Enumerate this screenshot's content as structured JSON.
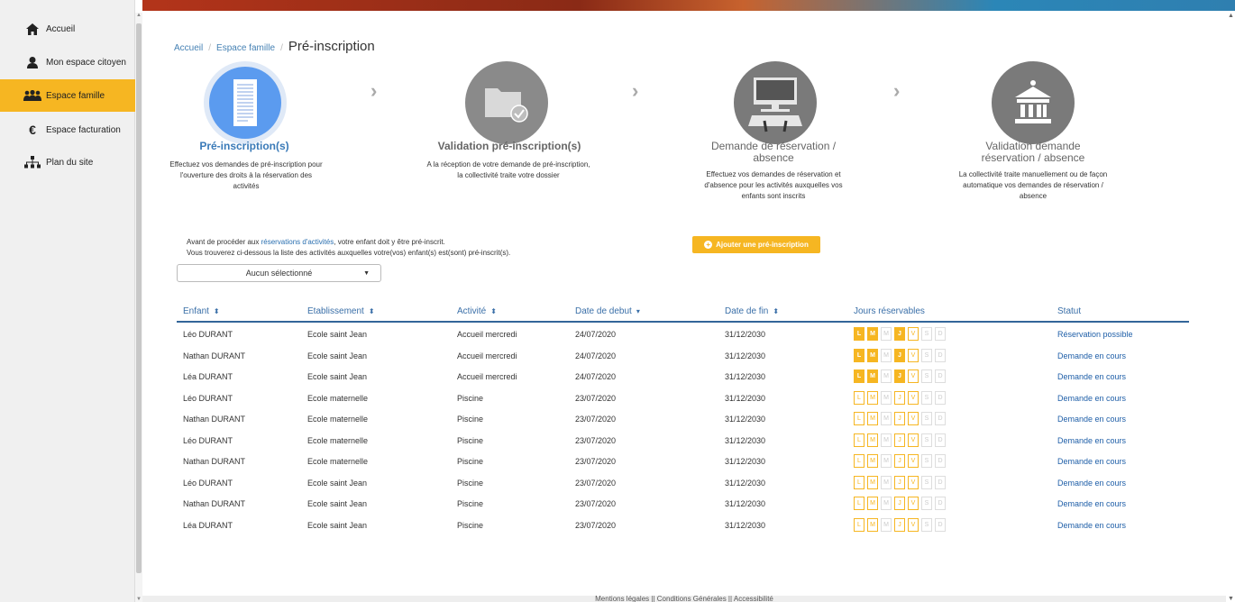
{
  "sidebar": {
    "items": [
      {
        "label": "Accueil",
        "icon": "home-icon",
        "active": false
      },
      {
        "label": "Mon espace citoyen",
        "icon": "user-icon",
        "active": false
      },
      {
        "label": "Espace famille",
        "icon": "family-icon",
        "active": true
      },
      {
        "label": "Espace facturation",
        "icon": "euro-icon",
        "active": false
      },
      {
        "label": "Plan du site",
        "icon": "sitemap-icon",
        "active": false
      }
    ]
  },
  "breadcrumb": {
    "items": [
      "Accueil",
      "Espace famille"
    ],
    "separator": "/",
    "current": "Pré-inscription"
  },
  "steps": [
    {
      "title": "Pré-inscription(s)",
      "desc": "Effectuez vos demandes de pré-inscription pour l'ouverture des droits à la réservation des activités",
      "icon": "document-icon",
      "active": true
    },
    {
      "title": "Validation pré-inscription(s)",
      "desc": "A la réception de votre demande de pré-inscription, la collectivité traite votre dossier",
      "icon": "folder-check-icon",
      "active": false
    },
    {
      "title": "Demande de réservation / absence",
      "desc": "Effectuez vos demandes de réservation et d'absence pour les activités auxquelles vos enfants sont inscrits",
      "icon": "computer-icon",
      "active": false
    },
    {
      "title": "Validation demande réservation / absence",
      "desc": "La collectivité traite manuellement ou de façon automatique vos demandes de réservation / absence",
      "icon": "institution-icon",
      "active": false
    }
  ],
  "intro": {
    "line1_before": "Avant de procéder aux ",
    "line1_link": "réservations d'activités",
    "line1_after": ", votre enfant doit y être pré-inscrit.",
    "line2": "Vous trouverez ci-dessous la liste des activités auxquelles votre(vos) enfant(s) est(sont) pré-inscrit(s)."
  },
  "add_button": "Ajouter une pré-inscription",
  "select": {
    "value": "Aucun sélectionné"
  },
  "table": {
    "headers": [
      "Enfant",
      "Etablissement",
      "Activité",
      "Date de debut",
      "Date de fin",
      "Jours réservables",
      "Statut"
    ],
    "day_letters": [
      "L",
      "M",
      "M",
      "J",
      "V",
      "S",
      "D"
    ],
    "rows": [
      {
        "enfant": "Léo DURANT",
        "etab": "Ecole saint Jean",
        "activite": "Accueil mercredi",
        "debut": "24/07/2020",
        "fin": "31/12/2030",
        "days": [
          "on",
          "on",
          "off",
          "on",
          "avail",
          "off",
          "off"
        ],
        "statut": "Réservation possible"
      },
      {
        "enfant": "Nathan DURANT",
        "etab": "Ecole saint Jean",
        "activite": "Accueil mercredi",
        "debut": "24/07/2020",
        "fin": "31/12/2030",
        "days": [
          "on",
          "on",
          "off",
          "on",
          "avail",
          "off",
          "off"
        ],
        "statut": "Demande en cours"
      },
      {
        "enfant": "Léa DURANT",
        "etab": "Ecole saint Jean",
        "activite": "Accueil mercredi",
        "debut": "24/07/2020",
        "fin": "31/12/2030",
        "days": [
          "on",
          "on",
          "off",
          "on",
          "avail",
          "off",
          "off"
        ],
        "statut": "Demande en cours"
      },
      {
        "enfant": "Léo DURANT",
        "etab": "Ecole maternelle",
        "activite": "Piscine",
        "debut": "23/07/2020",
        "fin": "31/12/2030",
        "days": [
          "avail",
          "avail",
          "off",
          "avail",
          "avail",
          "off",
          "off"
        ],
        "statut": "Demande en cours"
      },
      {
        "enfant": "Nathan DURANT",
        "etab": "Ecole maternelle",
        "activite": "Piscine",
        "debut": "23/07/2020",
        "fin": "31/12/2030",
        "days": [
          "avail",
          "avail",
          "off",
          "avail",
          "avail",
          "off",
          "off"
        ],
        "statut": "Demande en cours"
      },
      {
        "enfant": "Léo DURANT",
        "etab": "Ecole maternelle",
        "activite": "Piscine",
        "debut": "23/07/2020",
        "fin": "31/12/2030",
        "days": [
          "avail",
          "avail",
          "off",
          "avail",
          "avail",
          "off",
          "off"
        ],
        "statut": "Demande en cours"
      },
      {
        "enfant": "Nathan DURANT",
        "etab": "Ecole maternelle",
        "activite": "Piscine",
        "debut": "23/07/2020",
        "fin": "31/12/2030",
        "days": [
          "avail",
          "avail",
          "off",
          "avail",
          "avail",
          "off",
          "off"
        ],
        "statut": "Demande en cours"
      },
      {
        "enfant": "Léo DURANT",
        "etab": "Ecole saint Jean",
        "activite": "Piscine",
        "debut": "23/07/2020",
        "fin": "31/12/2030",
        "days": [
          "avail",
          "avail",
          "off",
          "avail",
          "avail",
          "off",
          "off"
        ],
        "statut": "Demande en cours"
      },
      {
        "enfant": "Nathan DURANT",
        "etab": "Ecole saint Jean",
        "activite": "Piscine",
        "debut": "23/07/2020",
        "fin": "31/12/2030",
        "days": [
          "avail",
          "avail",
          "off",
          "avail",
          "avail",
          "off",
          "off"
        ],
        "statut": "Demande en cours"
      },
      {
        "enfant": "Léa DURANT",
        "etab": "Ecole saint Jean",
        "activite": "Piscine",
        "debut": "23/07/2020",
        "fin": "31/12/2030",
        "days": [
          "avail",
          "avail",
          "off",
          "avail",
          "avail",
          "off",
          "off"
        ],
        "statut": "Demande en cours"
      }
    ]
  },
  "footer": "Mentions légales || Conditions Générales || Accessibilité",
  "colors": {
    "accent": "#f6b622",
    "link": "#1f5fa8",
    "active_step": "#5b9bef",
    "inactive_step": "#8a8a8a"
  }
}
